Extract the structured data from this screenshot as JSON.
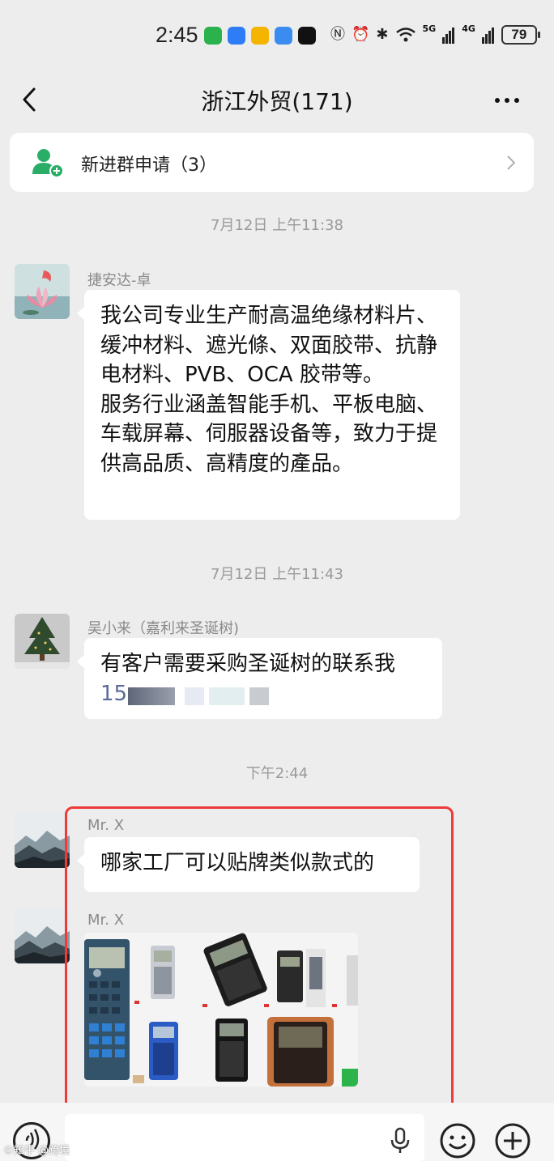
{
  "status_bar": {
    "time": "2:45",
    "network_5g": "5G",
    "network_4g": "4G",
    "battery": "79",
    "app_colors": [
      "#2bb24c",
      "#2e7cf6",
      "#f4b400",
      "#3b8cf0",
      "#111111"
    ]
  },
  "nav": {
    "title": "浙江外贸(171)",
    "back_icon": "chevron-left-icon",
    "more_icon": "more-dots-icon"
  },
  "join_request": {
    "label": "新进群申请（3）",
    "icon": "add-user-icon",
    "icon_color": "#2aae67"
  },
  "timestamps": {
    "t1": "7月12日 上午11:38",
    "t2": "7月12日 上午11:43",
    "t3": "下午2:44"
  },
  "messages": [
    {
      "sender": "捷安达-卓",
      "avatar": "lotus-koi-avatar",
      "paragraphs": [
        "我公司专业生产耐高温绝缘材料片、缓冲材料、遮光條、双面胶带、抗静电材料、PVB、OCA 胶带等。",
        "服务行业涵盖智能手机、平板电脑、车载屏幕、伺服器设备等，致力于提供高品质、高精度的產品。"
      ]
    },
    {
      "sender": "吴小来（嘉利来圣诞树)",
      "avatar": "christmas-tree-avatar",
      "text": "有客户需要采购圣诞树的联系我",
      "phone_prefix": "15"
    },
    {
      "sender": "Mr. X",
      "avatar": "mountain-avatar",
      "text": "哪家工厂可以贴牌类似款式的"
    },
    {
      "sender": "Mr. X",
      "avatar": "mountain-avatar",
      "image": "calculator-products-image"
    }
  ],
  "highlight_color": "#ee3a3a",
  "input_bar": {
    "voice_icon": "voice-toggle-icon",
    "mic_icon": "microphone-icon",
    "emoji_icon": "emoji-icon",
    "plus_icon": "plus-circle-icon"
  },
  "watermark": "©知乎 @跨境"
}
